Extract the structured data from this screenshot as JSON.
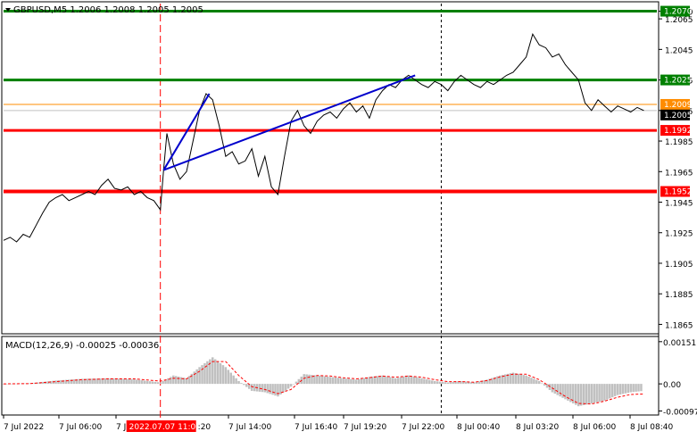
{
  "header": {
    "text": "GBPUSD,M5  1.2006 1.2008 1.2005 1.2005"
  },
  "macd_header": {
    "text": "MACD(12,26,9) -0.00025 -0.00036"
  },
  "colors": {
    "background": "#ffffff",
    "price_line": "#000000",
    "green_level": "#008000",
    "red_level": "#ff0000",
    "trend_line": "#0000cc",
    "current_price_line": "#c0c0c0",
    "orange_line": "#ff8c00",
    "macd_hist": "#c0c0c0",
    "macd_signal": "#ff0000",
    "selected_time_bg": "#ff0000",
    "grid": "#c8c8c8"
  },
  "chart_data": [
    {
      "type": "line",
      "name": "price",
      "y_ticks": [
        "1.2070",
        "1.2065",
        "1.2045",
        "1.2025",
        "1.2005",
        "1.1985",
        "1.1965",
        "1.1945",
        "1.1925",
        "1.1905",
        "1.1885",
        "1.1865"
      ],
      "ylim": [
        1.186,
        1.2075
      ],
      "x_labels": [
        "7 Jul 2022",
        "7 Jul 06:00",
        "7 Jul",
        "7 Jul 14:00",
        "7 Jul 16:40",
        "7 Jul 19:20",
        "7 Jul 22:00",
        "8 Jul 00:40",
        "8 Jul 03:20",
        "8 Jul 06:00",
        "8 Jul 08:40"
      ],
      "x_range": [
        0,
        100
      ],
      "selected_time_label": "2022.07.07 11:00",
      "selected_time_x": 24,
      "dashed_vline_x": 67,
      "levels": [
        {
          "label": "1.2070",
          "value": 1.207,
          "color": "#008000"
        },
        {
          "label": "1.2025",
          "value": 1.2025,
          "color": "#008000"
        },
        {
          "label": "1.1992",
          "value": 1.1992,
          "color": "#ff0000"
        },
        {
          "label": "1.1952",
          "value": 1.1952,
          "color": "#ff0000"
        }
      ],
      "current_price": {
        "label": "1.2005",
        "value": 1.2005
      },
      "orange_level": {
        "label": "1.2009",
        "value": 1.2009
      },
      "trend_lines": [
        {
          "x1": 24.5,
          "y1": 1.1966,
          "x2": 31.5,
          "y2": 1.2016
        },
        {
          "x1": 24.5,
          "y1": 1.1966,
          "x2": 63,
          "y2": 1.2028
        }
      ],
      "x": [
        0,
        1,
        2,
        3,
        4,
        5,
        6,
        7,
        8,
        9,
        10,
        11,
        12,
        13,
        14,
        15,
        16,
        17,
        18,
        19,
        20,
        21,
        22,
        23,
        24,
        24.5,
        25,
        26,
        27,
        28,
        29,
        30,
        31,
        32,
        33,
        34,
        35,
        36,
        37,
        38,
        39,
        40,
        41,
        42,
        43,
        44,
        45,
        46,
        47,
        48,
        49,
        50,
        51,
        52,
        53,
        54,
        55,
        56,
        57,
        58,
        59,
        60,
        61,
        62,
        63,
        64,
        65,
        66,
        67,
        68,
        69,
        70,
        71,
        72,
        73,
        74,
        75,
        76,
        77,
        78,
        79,
        80,
        81,
        82,
        83,
        84,
        85,
        86,
        87,
        88,
        89,
        90,
        91,
        92,
        93,
        94,
        95,
        96,
        97,
        98
      ],
      "y": [
        1.192,
        1.1922,
        1.1919,
        1.1924,
        1.1922,
        1.193,
        1.1938,
        1.1945,
        1.1948,
        1.195,
        1.1946,
        1.1948,
        1.195,
        1.1952,
        1.195,
        1.1956,
        1.196,
        1.1954,
        1.1953,
        1.1955,
        1.195,
        1.1952,
        1.1948,
        1.1946,
        1.194,
        1.1966,
        1.199,
        1.197,
        1.196,
        1.1965,
        1.1985,
        1.2005,
        1.2016,
        1.2012,
        1.1995,
        1.1975,
        1.1978,
        1.197,
        1.1972,
        1.198,
        1.1962,
        1.1975,
        1.1955,
        1.195,
        1.1975,
        1.1998,
        1.2005,
        1.1995,
        1.199,
        1.1998,
        1.2002,
        1.2004,
        1.2,
        1.2006,
        1.201,
        1.2004,
        1.2008,
        1.2,
        1.2012,
        1.2018,
        1.2022,
        1.202,
        1.2025,
        1.2028,
        1.2025,
        1.2022,
        1.202,
        1.2024,
        1.2022,
        1.2018,
        1.2024,
        1.2028,
        1.2025,
        1.2022,
        1.202,
        1.2024,
        1.2022,
        1.2025,
        1.2028,
        1.203,
        1.2035,
        1.204,
        1.2055,
        1.2048,
        1.2046,
        1.204,
        1.2042,
        1.2035,
        1.203,
        1.2025,
        1.201,
        1.2005,
        1.2012,
        1.2008,
        1.2004,
        1.2008,
        1.2006,
        1.2004,
        1.2007,
        1.2005
      ]
    },
    {
      "type": "bar",
      "name": "MACD(12,26,9)",
      "y_ticks": [
        "0.00151",
        "0.00",
        "-0.00097"
      ],
      "ylim": [
        -0.00105,
        0.0016
      ],
      "x": [
        0,
        4,
        8,
        12,
        16,
        20,
        24,
        26,
        28,
        30,
        32,
        34,
        36,
        38,
        40,
        42,
        44,
        46,
        48,
        50,
        52,
        54,
        56,
        58,
        60,
        62,
        64,
        66,
        68,
        70,
        72,
        74,
        76,
        78,
        80,
        82,
        84,
        86,
        88,
        90,
        92,
        94,
        96,
        98
      ],
      "values": [
        0.0,
        2e-05,
        0.00012,
        0.00018,
        0.0002,
        0.00016,
        5e-05,
        0.0003,
        0.0002,
        0.0006,
        0.00095,
        0.0006,
        0.0001,
        -0.00025,
        -0.0003,
        -0.00045,
        -0.0001,
        0.00035,
        0.0003,
        0.00025,
        0.0002,
        0.00015,
        0.00025,
        0.0003,
        0.0002,
        0.0003,
        0.0002,
        0.0001,
        5e-05,
        0.0001,
        5e-05,
        0.00015,
        0.0003,
        0.0004,
        0.0003,
        0.0001,
        -0.0003,
        -0.00055,
        -0.0008,
        -0.0007,
        -0.0006,
        -0.0004,
        -0.0003,
        -0.00025
      ],
      "signal": [
        0.0,
        1e-05,
        8e-05,
        0.00015,
        0.00018,
        0.00018,
        0.0001,
        0.0002,
        0.00018,
        0.00045,
        0.0008,
        0.0008,
        0.0003,
        -0.0001,
        -0.0002,
        -0.00035,
        -0.0002,
        0.0002,
        0.0003,
        0.00028,
        0.00022,
        0.00018,
        0.00022,
        0.00028,
        0.00024,
        0.00028,
        0.00024,
        0.00015,
        8e-05,
        8e-05,
        6e-05,
        0.00012,
        0.00025,
        0.00035,
        0.00035,
        0.00015,
        -0.00015,
        -0.00045,
        -0.0007,
        -0.00072,
        -0.00062,
        -0.00048,
        -0.00038,
        -0.00036
      ]
    }
  ]
}
